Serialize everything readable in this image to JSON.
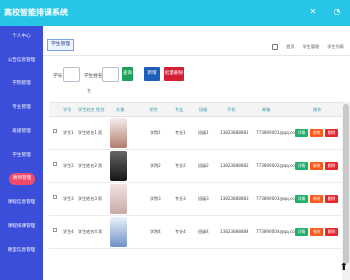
{
  "topbar": {
    "title": "高校智能排课系统",
    "icons": [
      "x-icon",
      "user-icon"
    ]
  },
  "sidebar": {
    "items": [
      "个人中心",
      "公告信息管理",
      "学院管理",
      "专业管理",
      "班级管理",
      "学生管理",
      "教师管理",
      "课程信息管理",
      "课程排课管理",
      "教室信息管理"
    ],
    "active_index": 6
  },
  "tab": {
    "label": "学生管理"
  },
  "breadcrumb": {
    "home": "首页",
    "current1": "学生管理",
    "current2": "学生列表"
  },
  "search": {
    "label1": "学号",
    "label2": "学生姓名",
    "sub": "名",
    "btn1": "查询",
    "btn2": "新增",
    "btn3": "批量删除"
  },
  "table": {
    "headers": [
      "学号",
      "学生姓名",
      "性别",
      "头像",
      "学院",
      "专业",
      "班级",
      "手机",
      "邮箱",
      "操作"
    ],
    "rows": [
      [
        "学生1",
        "学生姓名1",
        "男",
        "",
        "学院1",
        "专业1",
        "班级1",
        "13823888881",
        "773890001@qq.com"
      ],
      [
        "学生2",
        "学生姓名2",
        "男",
        "",
        "学院2",
        "专业2",
        "班级2",
        "13823888882",
        "773890002@qq.com"
      ],
      [
        "学生3",
        "学生姓名3",
        "男",
        "",
        "学院3",
        "专业3",
        "班级3",
        "13823888883",
        "773890003@qq.com"
      ],
      [
        "学生4",
        "学生姓名4",
        "男",
        "",
        "学院4",
        "专业4",
        "班级4",
        "13823888884",
        "773890004@qq.com"
      ]
    ],
    "actions": [
      "详情",
      "修改",
      "删除"
    ]
  }
}
